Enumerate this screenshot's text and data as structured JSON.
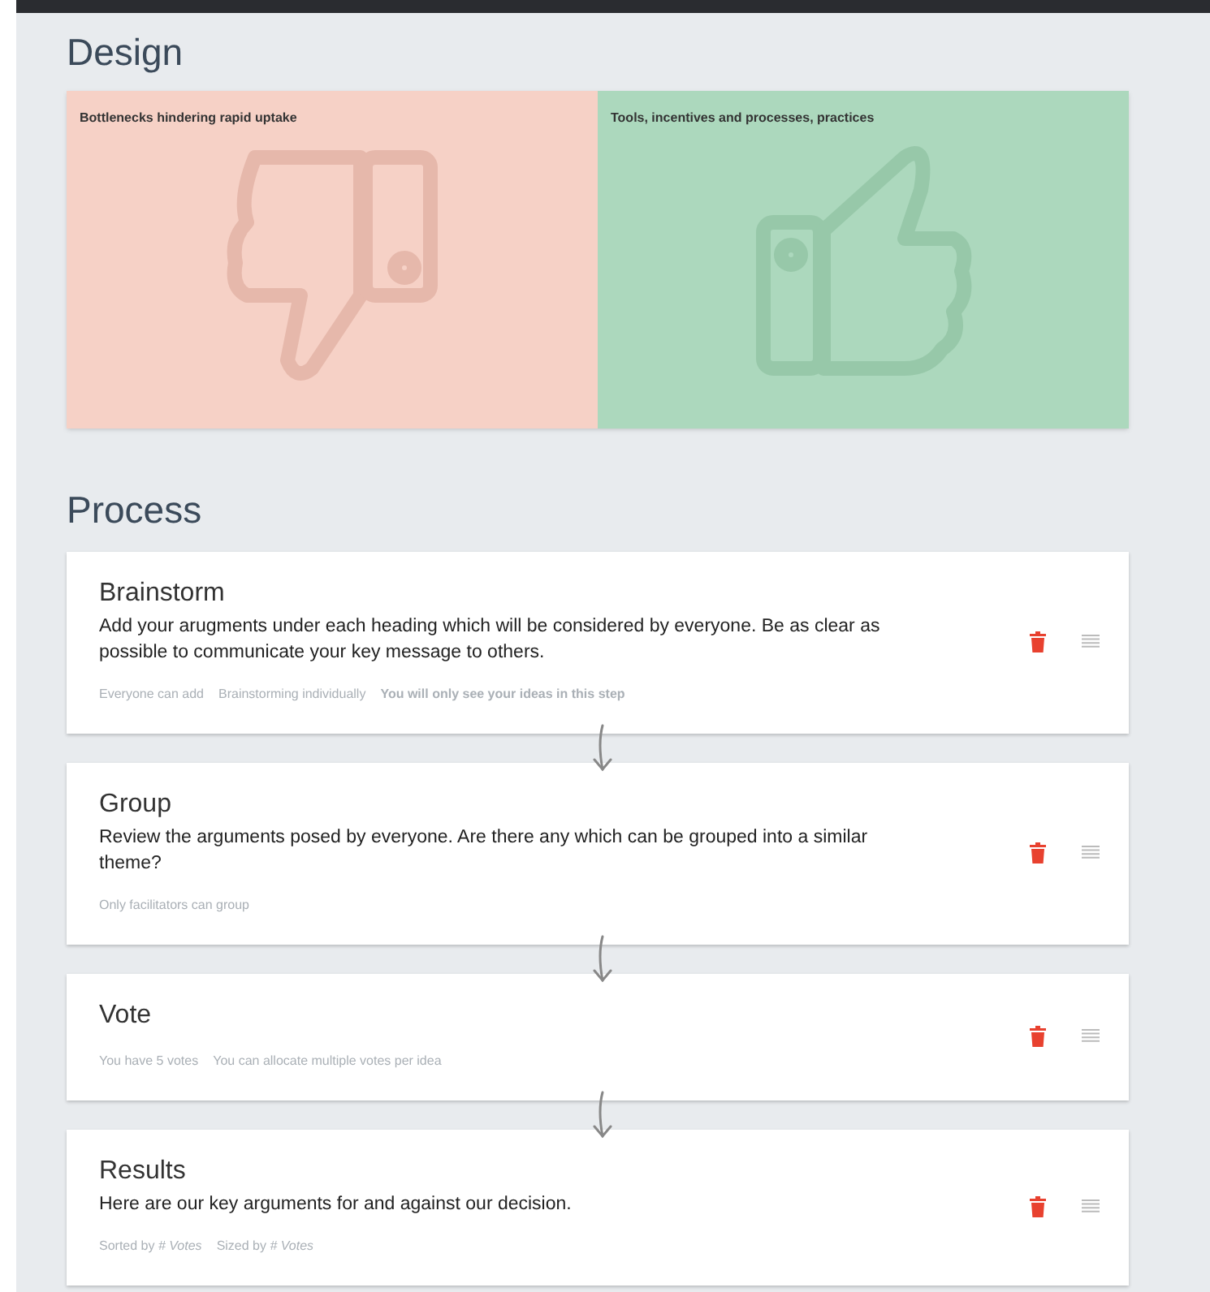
{
  "design": {
    "title": "Design",
    "quadrants": [
      {
        "label": "Bottlenecks hindering rapid uptake",
        "kind": "down",
        "color": "#f6d1c6"
      },
      {
        "label": "Tools, incentives and processes, practices",
        "kind": "up",
        "color": "#acd8bd"
      }
    ]
  },
  "process": {
    "title": "Process",
    "steps": [
      {
        "title": "Brainstorm",
        "description": "Add your arugments under each heading which will be considered by everyone. Be as clear as possible to communicate your key message to others.",
        "tags": [
          {
            "text": "Everyone can add",
            "bold": false
          },
          {
            "text": "Brainstorming individually",
            "bold": false
          },
          {
            "text": "You will only see your ideas in this step",
            "bold": true
          }
        ]
      },
      {
        "title": "Group",
        "description": "Review the arguments posed by everyone. Are there any which can be grouped into a similar theme?",
        "tags": [
          {
            "text": "Only facilitators can group",
            "bold": false
          }
        ]
      },
      {
        "title": "Vote",
        "tags": [
          {
            "text": "You have 5 votes",
            "bold": false
          },
          {
            "text": "You can allocate multiple votes per idea",
            "bold": false
          }
        ]
      },
      {
        "title": "Results",
        "description": "Here are our key arguments for and against our decision.",
        "tags": [
          {
            "text": "Sorted by *# Votes*",
            "bold": false
          },
          {
            "text": "Sized by *# Votes*",
            "bold": false
          }
        ]
      }
    ]
  }
}
